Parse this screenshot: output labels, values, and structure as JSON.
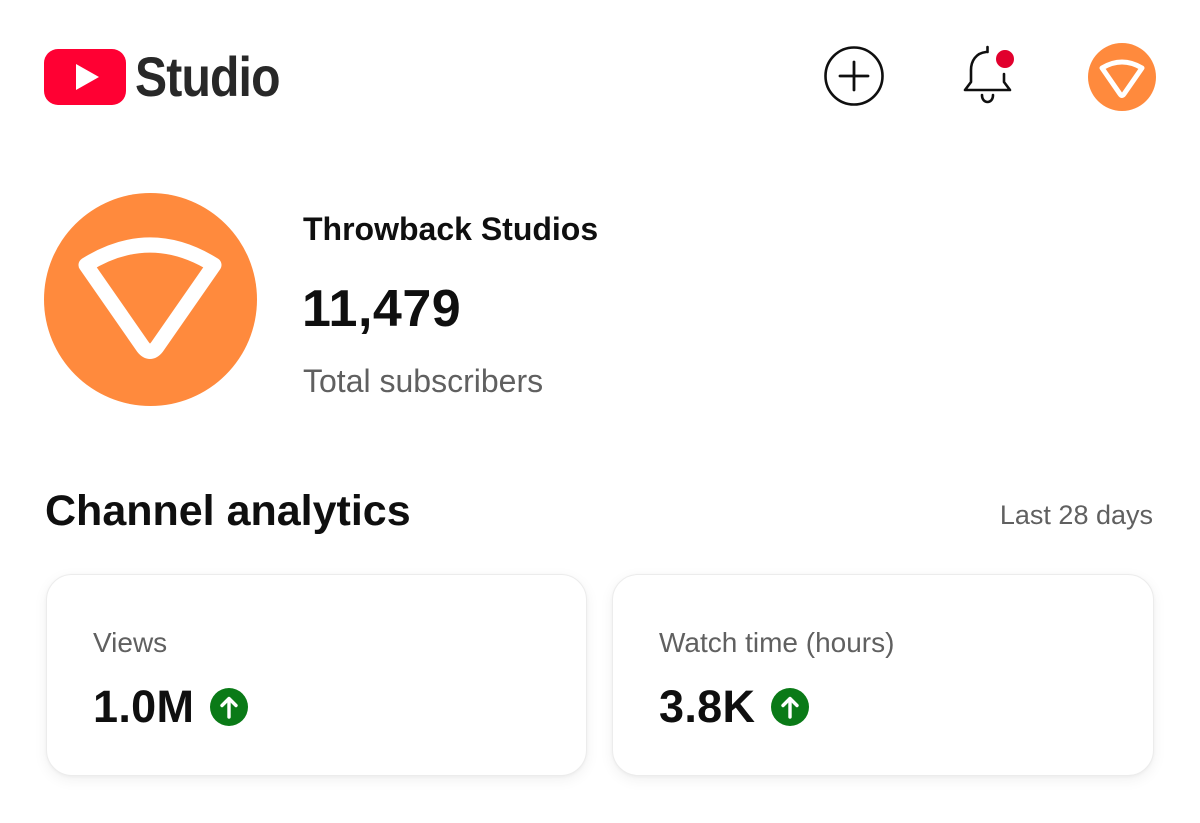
{
  "header": {
    "app_name": "Studio",
    "icons": {
      "logo": "youtube-play-logo",
      "create": "plus-circle-icon",
      "notifications": "bell-icon",
      "account": "channel-avatar-icon"
    },
    "notification_dot_color": "#e1002d"
  },
  "channel": {
    "name": "Throwback Studios",
    "subscriber_count": "11,479",
    "subscriber_label": "Total subscribers",
    "avatar_color": "#ff8a3d"
  },
  "analytics": {
    "title": "Channel analytics",
    "period": "Last 28 days",
    "cards": [
      {
        "label": "Views",
        "value": "1.0M",
        "trend": "up"
      },
      {
        "label": "Watch time (hours)",
        "value": "3.8K",
        "trend": "up"
      }
    ],
    "trend_up_color": "#0a7a17"
  },
  "colors": {
    "brand_red": "#ff0033",
    "text_primary": "#0f0f0f",
    "text_secondary": "#606060"
  }
}
